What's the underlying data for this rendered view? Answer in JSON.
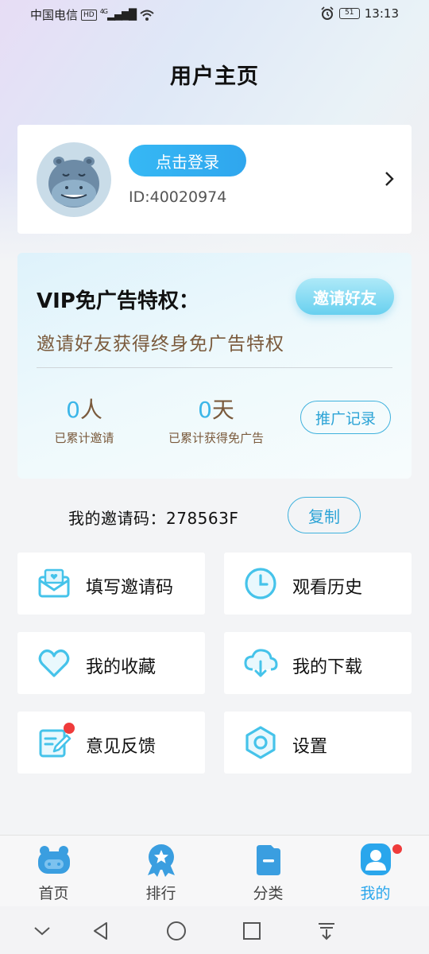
{
  "status_bar": {
    "carrier": "中国电信",
    "hd": "HD",
    "network": "4G",
    "battery": "51",
    "time": "13:13"
  },
  "page": {
    "title": "用户主页"
  },
  "profile": {
    "login_label": "点击登录",
    "user_id": "ID:40020974"
  },
  "vip": {
    "title": "VIP免广告特权：",
    "invite_button": "邀请好友",
    "description": "邀请好友获得终身免广告特权",
    "invited_count": "0",
    "invited_unit": "人",
    "invited_label": "已累计邀请",
    "days_count": "0",
    "days_unit": "天",
    "days_label": "已累计获得免广告",
    "record_button": "推广记录"
  },
  "invite_code": {
    "label": "我的邀请码：",
    "code": "278563F",
    "copy_button": "复制"
  },
  "menu": {
    "fill_invite_code": "填写邀请码",
    "watch_history": "观看历史",
    "favorites": "我的收藏",
    "downloads": "我的下载",
    "feedback": "意见反馈",
    "settings": "设置"
  },
  "bottom_nav": {
    "home": "首页",
    "ranking": "排行",
    "category": "分类",
    "mine": "我的"
  },
  "colors": {
    "accent": "#2aa6ec",
    "login_button": "#36b8f4",
    "vip_text_brown": "#7a5a3c",
    "notification_dot": "#ef3b3b"
  }
}
